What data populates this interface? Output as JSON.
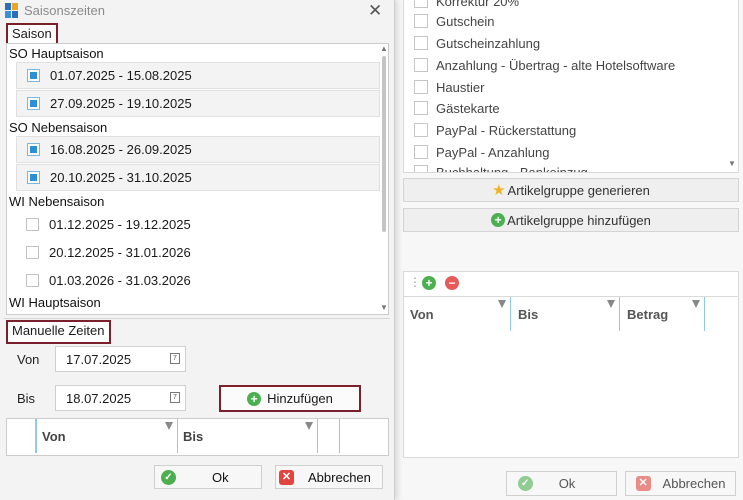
{
  "background": {
    "list_items": [
      "Korrektur 20%",
      "Gutschein",
      "Gutscheinzahlung",
      "Anzahlung - Übertrag - alte Hotelsoftware",
      "Haustier",
      "Gästekarte",
      "PayPal - Rückerstattung",
      "PayPal - Anzahlung",
      "Buchhaltung - Bankeinzug"
    ],
    "generate_button": "Artikelgruppe generieren",
    "add_group_button": "Artikelgruppe hinzufügen",
    "grid_columns": [
      "Von",
      "Bis",
      "Betrag"
    ],
    "ok_button": "Ok",
    "cancel_button": "Abbrechen"
  },
  "dialog": {
    "title": "Saisonszeiten",
    "season_section_label": "Saison",
    "groups": [
      {
        "name": "SO Hauptsaison",
        "items": [
          {
            "label": "01.07.2025 - 15.08.2025",
            "checked": true
          },
          {
            "label": "27.09.2025 - 19.10.2025",
            "checked": true
          }
        ]
      },
      {
        "name": "SO Nebensaison",
        "items": [
          {
            "label": "16.08.2025 - 26.09.2025",
            "checked": true
          },
          {
            "label": "20.10.2025 - 31.10.2025",
            "checked": true
          }
        ]
      },
      {
        "name": "WI Nebensaison",
        "items": [
          {
            "label": "01.12.2025 - 19.12.2025",
            "checked": false
          },
          {
            "label": "20.12.2025 - 31.01.2026",
            "checked": false
          },
          {
            "label": "01.03.2026 - 31.03.2026",
            "checked": false
          }
        ]
      },
      {
        "name": "WI Hauptsaison",
        "items": []
      }
    ],
    "manual_section_label": "Manuelle Zeiten",
    "from_label": "Von",
    "from_value": "17.07.2025",
    "to_label": "Bis",
    "to_value": "18.07.2025",
    "add_button": "Hinzufügen",
    "manual_columns": [
      "Von",
      "Bis"
    ],
    "ok_button": "Ok",
    "cancel_button": "Abbrechen"
  },
  "colors": {
    "highlight_border": "#7b1f2b",
    "checkbox_checked": "#2d8fd6",
    "column_divider": "#8fcbe9"
  }
}
